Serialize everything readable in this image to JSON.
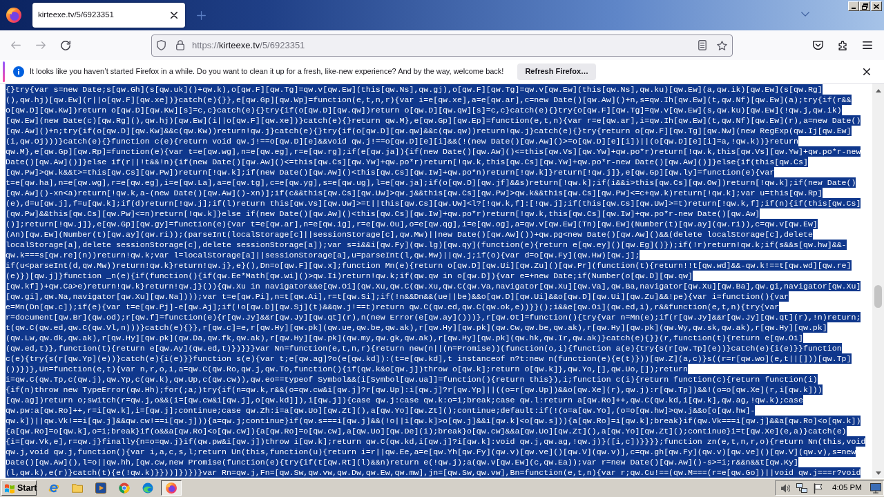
{
  "tabs": [
    {
      "title": "kirteexe.tv/5/6923351",
      "selected": true
    }
  ],
  "toolbar": {
    "buttons": [
      {
        "kind": "back",
        "disabled": true
      },
      {
        "kind": "forward",
        "disabled": true
      },
      {
        "kind": "reload",
        "disabled": false
      }
    ]
  },
  "address_bar": {
    "scheme": "https://",
    "host": "kirteexe.tv",
    "path": "/5/6923351"
  },
  "notification": {
    "message": "It looks like you haven’t started Firefox in a while. Do you want to clean it up for a fresh, like-new experience? And by the way, welcome back!",
    "button": "Refresh Firefox…"
  },
  "code": {
    "selected": true,
    "lines": [
      "{}try{var s=new Date;s[qw.Gh](s[qw.uk]()+qw.k),o[qw.F][qw.Tg]=qw.v[qw.Ew](this[qw.Ns],qw.gj),o[qw.F][qw.Tg]=qw.v[qw.Ew](this[qw.Ns],qw.ku)[qw.Ew](a,qw.ik)[qw.Ew](s[qw.Rg]",
      "(),qw.hj)[qw.Ew](r||o[qw.F][qw.xe])}catch(e){}},e[qw.Gp][qw.Wp]=function(e,t,n,r){var i=e[qw.xe],a=e[qw.ar],c=new Date()[qw.Aw]()+n,s=qw.Ih[qw.Ew](t,qw.Nf)[qw.Ew](a);try{if(r&&",
      "o[qw.D][qw.Kw])return o[qw.D][qw.Kw][s]=c,c}catch(e){}try{if(o[qw.D][qw.qw])return o[qw.D][qw.qw][s]=c,c}catch(e){}try{o[qw.F][qw.Tg]=qw.v[qw.Ew](s,qw.ku)[qw.Ew](!qw.j,qw.ik)",
      "[qw.Ew](new Date(c)[qw.Rg](),qw.hj)[qw.Ew](i||o[qw.F][qw.xe])}catch(e){}return qw.M},e[qw.Gp][qw.Ep]=function(e,t,n){var r=e[qw.ar],i=qw.Ih[qw.Ew](t,qw.Nf)[qw.Ew](r),a=new Date()",
      "[qw.Aw]()+n;try{if(o[qw.D][qw.Kw]&&c(qw.Kw))return!qw.j}catch(e){}try{if(o[qw.D][qw.qw]&&c(qw.qw))return!qw.j}catch(e){}try{return o[qw.F][qw.Tg][qw.Nw](new RegExp(qw.Ij[qw.Ew]",
      "(i,qw.Oj)))}catch(e){}function c(e){return void qw.j!==o[qw.D][e]&&void qw.j!==o[qw.D][e][i]&&(!(new Date()[qw.Aw]()>=o[qw.D][e][i])||(o[qw.D][e][i]=a,!qw.k))}return",
      "qw.M},e[qw.Gp][qw.Rp]=function(e){var t=e[qw.wg],n=e[qw.eg],r=e[qw.rg];if(e[qw.ja]){if(new Date()[qw.Aw]()<=this[qw.Vs][qw.Yw]+qw.po*r)return[!qw.k,this[qw.Vs][qw.Yw]+qw.po*r-new",
      "Date()[qw.Aw]()]}else if(r||!t&&!n){if(new Date()[qw.Aw]()<=this[qw.Cs][qw.Yw]+qw.po*r)return[!qw.k,this[qw.Cs][qw.Yw]+qw.po*r-new Date()[qw.Aw]()]}else{if(this[qw.Cs]",
      "[qw.Pw]>qw.k&&t>=this[qw.Cs][qw.Pw])return[!qw.k];if(new Date()[qw.Aw]()<this[qw.Cs][qw.Iw]+qw.po*n)return[!qw.k]}return[!qw.j]},e[qw.Gp][qw.ly]=function(e){var",
      "t=e[qw.ha],n=e[qw.wg],r=e[qw.eg],i=e[qw.La],a=e[qw.tg],c=e[qw.yg],s=e[qw.ug],l=e[qw.ja];if(o[qw.D][qw.jf]&&s)return[!qw.k];if(i&&i>this[qw.Cs][qw.Ow])return[!qw.k];if(new Date()",
      "[qw.Aw]()-xn<a)return[!qw.k,a-(new Date()[qw.Aw]()-xn)];if(c&&this[qw.Cs][qw.Uw]>qw.j&&this[qw.Cs][qw.Pw]>qw.k&&this[qw.Cs][qw.Pw]<=c+qw.k)return[!qw.k];var u=this[qw.Rp]",
      "(e),d=u[qw.j],f=u[qw.k];if(d)return[!qw.j];if(l)return this[qw.Vs][qw.Uw]>=t||this[qw.Cs][qw.Uw]<l?[!qw.k,f]:[!qw.j];if(this[qw.Cs][qw.Uw]>=t)return[!qw.k,f];if(n){if(this[qw.Cs]",
      "[qw.Pw]&&this[qw.Cs][qw.Pw]<=n)return[!qw.k]}else if(new Date()[qw.Aw]()<this[qw.Cs][qw.Iw]+qw.po*r)return[!qw.k,this[qw.Cs][qw.Iw]+qw.po*r-new Date()[qw.Aw]",
      "()];return[!qw.j]},e[qw.Gp][qw.gy]=function(e){var t=e[qw.ar],n=e[qw.ig],r=e[qw.Ou],o=e[qw.qg],i=e[qw.og],a=qw.v[qw.Ew](Tn)[qw.Ew](Number(t)[qw.ay](qw.ri)),c=qw.v[qw.Ew]",
      "(An)[qw.Ew](Number(t)[qw.ay](qw.ri));(parseInt(localStorage[c]||sessionStorage[c],qw.Mw)||new Date()[qw.Aw]())+qw.pg<new Date()[qw.Aw]()&&(delete localStorage[c],delete",
      "localStorage[a],delete sessionStorage[c],delete sessionStorage[a]);var s=i&&i[qw.Fy](qw.lg)[qw.qy](function(e){return e[qw.ey]()[qw.Eg]()});if(!r)return!qw.k;if(s&&s[qw.hw]&&-",
      "qw.k===s[qw.re](n))return!qw.k;var l=localStorage[a]||sessionStorage[a],u=parseInt(l,qw.Mw)||qw.j;if(o){var d=o[qw.Fy](qw.Hw)[qw.j];",
      "if(u<parseInt(d,qw.Mw))return!qw.k}return!qw.j},e}(),Dn=o[qw.F][qw.x];function Mn(e){return o[qw.D][qw.Ui][qw.Zu]()[qw.Pr](function(t){return!!t[qw.wd]&&-qw.k!==t[qw.wd][qw.re]",
      "(e)})[qw.j]}function _n(e){if(function(){if(qw.Ee*Math[qw.wi]()>qw.Ii)return!qw.k;if(qw.qw in o[qw.D]){var e=+new Date;if(Number(o[qw.D][qw.qw]",
      "[qw.kf])+qw.Ca>e)return!qw.k}return!qw.j}()){qw.Xu in navigator&&e[qw.Oi](qw.Xu,qw.C(qw.Xu,qw.C(qw.Va,navigator[qw.Xu][qw.Va],qw.Ba,navigator[qw.Xu][qw.Ba],qw.gi,navigator[qw.Xu]",
      "[qw.gi],qw.Na,navigator[qw.Xu][qw.Na])));var t=e[qw.Pi],n=t[qw.Ai],r=t[qw.Si];if(!n&&Dn&&(ue||be)&&o[qw.D][qw.Ui]&&o[qw.D][qw.Ui][qw.Zu]&&!pe){var i=function(){var",
      "e=Mn(Dn[qw.c]);if(e){var t=e[qw.Pj]-e[qw.Aj];if(!o[qw.D][qw.Sj](t)&&qw.j!==t)return qw.C(qw.ed,qw.C(qw.ok,e))}}();i&&e[qw.Oi](qw.ed,i),r&&function(e,t,n){try{var",
      "r=document[qw.Br](qw.od);r[qw.f]=function(e){r[qw.Jy]&&r[qw.Jy][qw.qt](r),n(new Error(e[qw.ay]()))},r[qw.Ot]=function(){try{var n=Mn(e);if(r[qw.Jy]&&r[qw.Jy][qw.qt](r),!n)return;",
      "t(qw.C(qw.ed,qw.C(qw.Vl,n)))}catch(e){}},r[qw.c]=e,r[qw.Hy][qw.pk](qw.ue,qw.be,qw.ak),r[qw.Hy][qw.pk](qw.Cw,qw.be,qw.ak),r[qw.Hy][qw.pk](qw.Wy,qw.sk,qw.ak),r[qw.Hy][qw.pk]",
      "(qw.Lw,qw.dk,qw.ak),r[qw.Hy][qw.pk](qw.Da,qw.fk,qw.ak),r[qw.Hy][qw.pk](qw.my,qw.gk,qw.ak),r[qw.Hy][qw.pk](qw.hk,qw.Ir,qw.ak)}catch(e){}}(r,function(t){return e[qw.Oi]",
      "(qw.ed,t)},function(t){return e[qw.Ay](qw.ed,t)})}}}var Nn=function(e,t,n,r){return new(n||(n=Promise))(function(o,i){function a(e){try{s(r[qw.Tp](e))}catch(e){i(e)}}function",
      "c(e){try{s(r[qw.Yp](e))}catch(e){i(e)}}function s(e){var t;e[qw.ag]?o(e[qw.kd]):(t=e[qw.kd],t instanceof n?t:new n(function(e){e(t)}))[qw.Z](a,c)}s((r=r[qw.wo](e,t||[]))[qw.Tp]",
      "())})},Un=function(e,t){var n,r,o,i,a=qw.C(qw.Ro,qw.j,qw.To,function(){if(qw.k&o[qw.j])throw o[qw.k];return o[qw.k]},qw.Yo,[],qw.Uo,[]);return",
      "i=qw.C(qw.Tp,c(qw.j),qw.Yp,c(qw.k),qw.Up,c(qw.cw)),qw.eo==typeof Symbol&&(i[Symbol[qw.ua]]=function(){return this}),i;function c(i){return function(c){return function(i)",
      "{if(n)throw new TypeError(qw.Hh);for(;a;)try{if(n=qw.k,r&&(o=qw.cw&i[qw.j]?r[qw.Up]:i[qw.j]?r[qw.Yp]||((o=r[qw.Up])&&o[qw.Xe](r),qw.j):r[qw.Tp])&&!(o=o[qw.Xe](r,i[qw.k]))",
      "[qw.ag])return o;switch(r=qw.j,o&&(i=[qw.cw&i[qw.j],o[qw.kd]]),i[qw.j]){case qw.j:case qw.k:o=i;break;case qw.l:return a[qw.Ro]++,qw.C(qw.kd,i[qw.k],qw.ag,!qw.k);case",
      "qw.pw:a[qw.Ro]++,r=i[qw.k],i=[qw.j];continue;case qw.Zh:i=a[qw.Uo][qw.Zt](),a[qw.Yo][qw.Zt]();continue;default:if(!(o=a[qw.Yo],(o=o[qw.hw]>qw.j&&o[o[qw.hw]-",
      "qw.k])||qw.Vk!==i[qw.j]&&qw.cw!==i[qw.j])){a=qw.j;continue}if(qw.s===i[qw.j]&&(!o||i[qw.k]>o[qw.j]&&i[qw.k]<o[qw.s])){a[qw.Ro]=i[qw.k];break}if(qw.Vk===i[qw.j]&&a[qw.Ro]<o[qw.k])",
      "{a[qw.Ro]=o[qw.k],o=i;break}if(o&&a[qw.Ro]<o[qw.cw]){a[qw.Ro]=o[qw.cw],a[qw.Uo][qw.De](i);break}o[qw.cw]&&a[qw.Uo][qw.Zt](),a[qw.Yo][qw.Zt]();continue}i=t[qw.Xe](e,a)}catch(e)",
      "{i=[qw.Vk,e],r=qw.j}finally{n=o=qw.j}if(qw.pw&i[qw.j])throw i[qw.k];return qw.C(qw.kd,i[qw.j]?i[qw.k]:void qw.j,qw.ag,!qw.j)}([i,c])}}}};function zn(e,t,n,r,o){return Nn(this,void",
      "qw.j,void qw.j,function(){var i,a,c,s,l;return Un(this,function(u){return i=r||qw.Ee,a=e[qw.Yh[qw.Fy](qw.v)[qw.ve]()[qw.V](qw.v)],c=qw.gh[qw.Fy](qw.v)[qw.ve]()[qw.V](qw.v),s=new",
      "Date()[qw.Aw](),l=o||qw.hh,[qw.cw,new Promise(function(e){try{if(t[qw.Rt](l)&&n)return e(!qw.j);a(qw.v[qw.Ew](c,qw.Ea));var r=new Date()[qw.Aw]()-s>=i;r&&n&&t[qw.Ky]",
      "(l,qw.k),e(r)}catch(t){e(!qw.k)}}))]})})}var Rn=qw.j,Fn=[qw.Sw,qw.vw,qw.Dw,qw.Ew,qw.mw],jn=[qw.Sw,qw.vw],Bn=function(e,t,n){var r;qw.Cu!==(qw.M===(r=e[qw.Go])||void qw.j===r?void"
    ]
  },
  "taskbar": {
    "start": "Start",
    "apps": [
      {
        "kind": "letter-e",
        "selected": false
      },
      {
        "kind": "folder",
        "selected": false
      },
      {
        "kind": "player",
        "selected": false
      },
      {
        "kind": "segmented",
        "selected": false
      },
      {
        "kind": "wave",
        "selected": false
      },
      {
        "kind": "fox",
        "selected": true
      }
    ],
    "clock": "4:05 PM"
  }
}
